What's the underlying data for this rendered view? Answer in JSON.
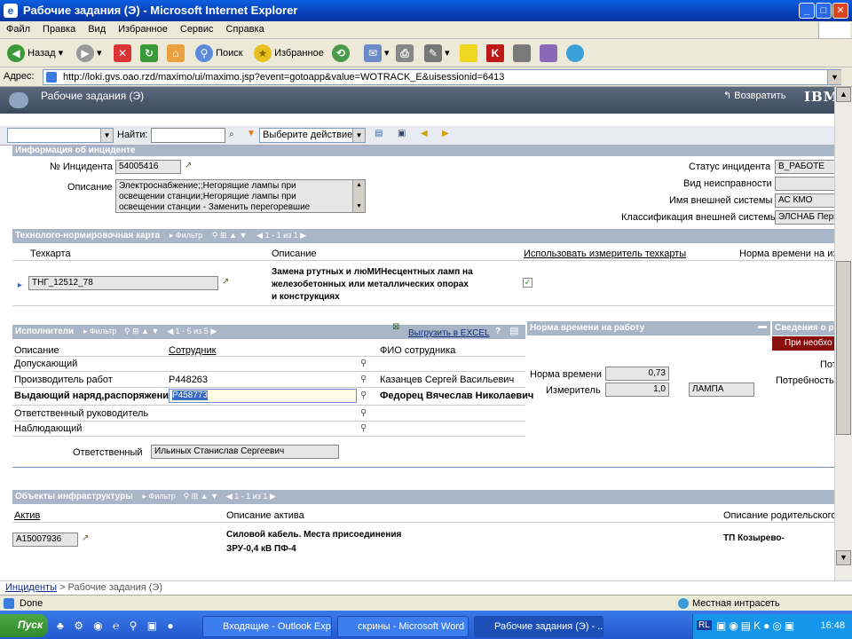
{
  "window": {
    "title": "Рабочие задания (Э) - Microsoft Internet Explorer"
  },
  "menu": [
    "Файл",
    "Правка",
    "Вид",
    "Избранное",
    "Сервис",
    "Справка"
  ],
  "toolbar": {
    "back": "Назад",
    "search": "Поиск",
    "favorites": "Избранное"
  },
  "address": {
    "label": "Адрес:",
    "url": "http://loki.gvs.oao.rzd/maximo/ui/maximo.jsp?event=gotoapp&value=WOTRACK_E&uisessionid=6413"
  },
  "app": {
    "title": "Рабочие задания (Э)",
    "back": "Возвратить",
    "logo": "IBM"
  },
  "app_toolbar": {
    "find_label": "Найти:",
    "action_select": "Выберите действие"
  },
  "incident": {
    "section_title": "Информация об инциденте",
    "number_label": "№ Инцидента",
    "number": "54005416",
    "description_label": "Описание",
    "description_lines": [
      "Электроснабжение;;Негорящие лампы при",
      "освещении станции;Негорящие лампы при",
      "освещении станции - Заменить перегоревшие"
    ],
    "status_label": "Статус инцидента",
    "status": "В_РАБОТЕ",
    "fault_type_label": "Вид неисправности",
    "fault_type": "",
    "ext_system_label": "Имя внешней системы",
    "ext_system": "АС КМО",
    "ext_class_label": "Классификация внешней системы",
    "ext_class": "ЭЛСНАБ Перг"
  },
  "techcard": {
    "section_title": "Технолого-нормировочная карта",
    "filter": "Фильтр",
    "paging": "1 - 1 из 1",
    "col_card": "Техкарта",
    "col_desc": "Описание",
    "col_use": "Использовать измеритель техкарты",
    "col_norm": "Норма времени на из",
    "row": {
      "card": "ТНГ_12512_78",
      "desc_lines": [
        "Замена ртутных и люМИНесцентных ламп на",
        "железобетонных или металлических опорах",
        "и конструкциях"
      ],
      "use_meter": true
    }
  },
  "executors": {
    "section_title": "Исполнители",
    "filter": "Фильтр",
    "paging": "1 - 5 из 5",
    "export": "Выгрузить в EXCEL",
    "help": "?",
    "col_desc": "Описание",
    "col_emp": "Сотрудник",
    "col_fio": "ФИО сотрудника",
    "rows": [
      {
        "desc": "Допускающий",
        "emp": "",
        "fio": "",
        "bold": false
      },
      {
        "desc": "Производитель работ",
        "emp": "Р448263",
        "fio": "Казанцев Сергей Васильевич",
        "bold": false
      },
      {
        "desc": "Выдающий наряд,распоряжение",
        "emp": "Р458773",
        "fio": "Федорец Вячеслав Николаевич",
        "bold": true
      },
      {
        "desc": "Ответственный руководитель",
        "emp": "",
        "fio": "",
        "bold": false
      },
      {
        "desc": "Наблюдающий",
        "emp": "",
        "fio": "",
        "bold": false
      }
    ],
    "responsible_label": "Ответственный",
    "responsible": "Ильиных Станислав Сергеевич"
  },
  "norm": {
    "section_title": "Норма времени на работу",
    "norm_label": "Норма времени",
    "norm_value": "0,73",
    "meter_label": "Измеритель",
    "meter_value": "1,0",
    "meter_unit": "ЛАМПА"
  },
  "info": {
    "section_title": "Сведения о р",
    "button": "При необхо",
    "label1": "Пот",
    "label2": "Потребность"
  },
  "infra": {
    "section_title": "Объекты инфраструктуры",
    "filter": "Фильтр",
    "paging": "1 - 1 из 1",
    "col_asset": "Актив",
    "col_desc": "Описание актива",
    "col_parent": "Описание родительского а",
    "row": {
      "asset": "А15007936",
      "desc_lines": [
        "Силовой кабель. Места присоединения",
        "ЗРУ-0,4 кВ ПФ-4"
      ],
      "parent": "ТП Козырево-"
    }
  },
  "breadcrumbs": {
    "link": "Инциденты",
    "current": "> Рабочие задания (Э)"
  },
  "status": {
    "left": "Done",
    "zone": "Местная интрасеть"
  },
  "taskbar": {
    "start": "Пуск",
    "tasks": [
      "Входящие - Outlook Exp...",
      "скрины - Microsoft Word",
      "Рабочие задания (Э) - ..."
    ],
    "lang": "RL",
    "clock": "16:48"
  }
}
